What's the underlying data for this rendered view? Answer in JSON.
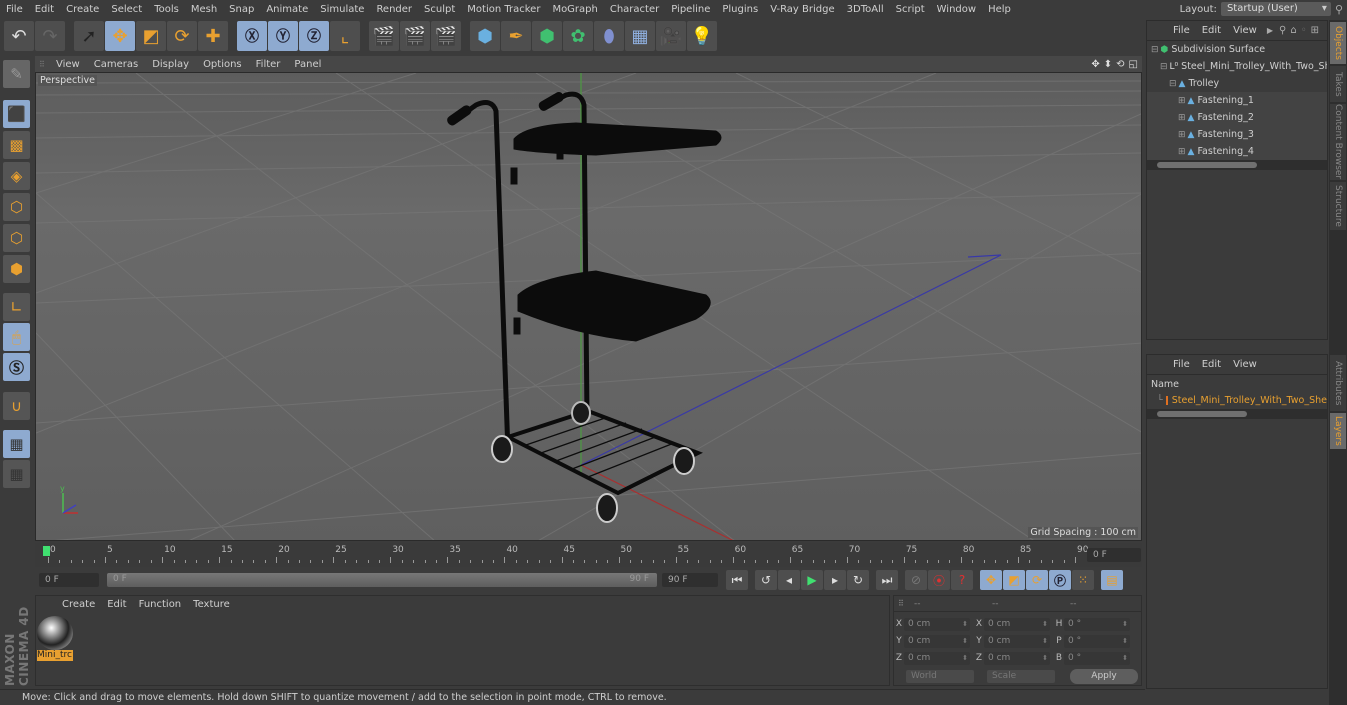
{
  "menubar": {
    "items": [
      "File",
      "Edit",
      "Create",
      "Select",
      "Tools",
      "Mesh",
      "Snap",
      "Animate",
      "Simulate",
      "Render",
      "Sculpt",
      "Motion Tracker",
      "MoGraph",
      "Character",
      "Pipeline",
      "Plugins",
      "V-Ray Bridge",
      "3DToAll",
      "Script",
      "Window",
      "Help"
    ],
    "layout_label": "Layout:",
    "layout_value": "Startup (User)"
  },
  "toolbar": {
    "icons": [
      "undo-icon",
      "redo-icon",
      "select-arrow-icon",
      "move-icon",
      "scale-icon",
      "rotate-icon",
      "move-plus-icon",
      "x-axis-icon",
      "y-axis-icon",
      "z-axis-icon",
      "coordinate-system-icon",
      "render-view-icon",
      "render-picture-viewer-icon",
      "render-settings-icon",
      "cube-icon",
      "pen-spline-icon",
      "subdivision-icon",
      "cloner-icon",
      "deformer-icon",
      "floor-icon",
      "camera-icon",
      "light-icon"
    ]
  },
  "viewport": {
    "menu": [
      "View",
      "Cameras",
      "Display",
      "Options",
      "Filter",
      "Panel"
    ],
    "label": "Perspective",
    "grid_spacing": "Grid Spacing : 100 cm"
  },
  "timeline": {
    "ticks": [
      "0",
      "5",
      "10",
      "15",
      "20",
      "25",
      "30",
      "35",
      "40",
      "45",
      "50",
      "55",
      "60",
      "65",
      "70",
      "75",
      "80",
      "85",
      "90"
    ],
    "current_frame": "0 F",
    "start_field": "0 F",
    "slider_start": "0 F",
    "slider_end": "90 F",
    "end_field": "90 F"
  },
  "material_panel": {
    "menu": [
      "Create",
      "Edit",
      "Function",
      "Texture"
    ],
    "materials": [
      {
        "name": "Mini_trc"
      }
    ]
  },
  "coords": {
    "headers": [
      "--",
      "--",
      "--"
    ],
    "rows": [
      {
        "l1": "X",
        "v1": "0 cm",
        "l2": "X",
        "v2": "0 cm",
        "l3": "H",
        "v3": "0 °"
      },
      {
        "l1": "Y",
        "v1": "0 cm",
        "l2": "Y",
        "v2": "0 cm",
        "l3": "P",
        "v3": "0 °"
      },
      {
        "l1": "Z",
        "v1": "0 cm",
        "l2": "Z",
        "v2": "0 cm",
        "l3": "B",
        "v3": "0 °"
      }
    ],
    "mode": "World",
    "type": "Scale",
    "apply": "Apply"
  },
  "status": "Move: Click and drag to move elements. Hold down SHIFT to quantize movement / add to the selection in point mode, CTRL to remove.",
  "object_panel": {
    "menu": [
      "File",
      "Edit",
      "View"
    ],
    "objects": [
      {
        "name": "Subdivision Surface",
        "indent": 0,
        "icon": "subdivision-icon"
      },
      {
        "name": "Steel_Mini_Trolley_With_Two_Sh",
        "indent": 1,
        "icon": "null-object-icon"
      },
      {
        "name": "Trolley",
        "indent": 2,
        "icon": "polygon-object-icon"
      },
      {
        "name": "Fastening_1",
        "indent": 3,
        "icon": "polygon-object-icon"
      },
      {
        "name": "Fastening_2",
        "indent": 3,
        "icon": "polygon-object-icon"
      },
      {
        "name": "Fastening_3",
        "indent": 3,
        "icon": "polygon-object-icon"
      },
      {
        "name": "Fastening_4",
        "indent": 3,
        "icon": "polygon-object-icon"
      }
    ]
  },
  "layer_panel": {
    "menu": [
      "File",
      "Edit",
      "View"
    ],
    "column": "Name",
    "layers": [
      {
        "name": "Steel_Mini_Trolley_With_Two_She",
        "color": "#e07020"
      }
    ]
  },
  "side_tabs": [
    "Objects",
    "Takes",
    "Content Browser",
    "Structure",
    "Attributes",
    "Layers"
  ],
  "colors": {
    "accent": "#e8a030",
    "selected_tool": "#8eaad0",
    "layer_color": "#e07020"
  }
}
